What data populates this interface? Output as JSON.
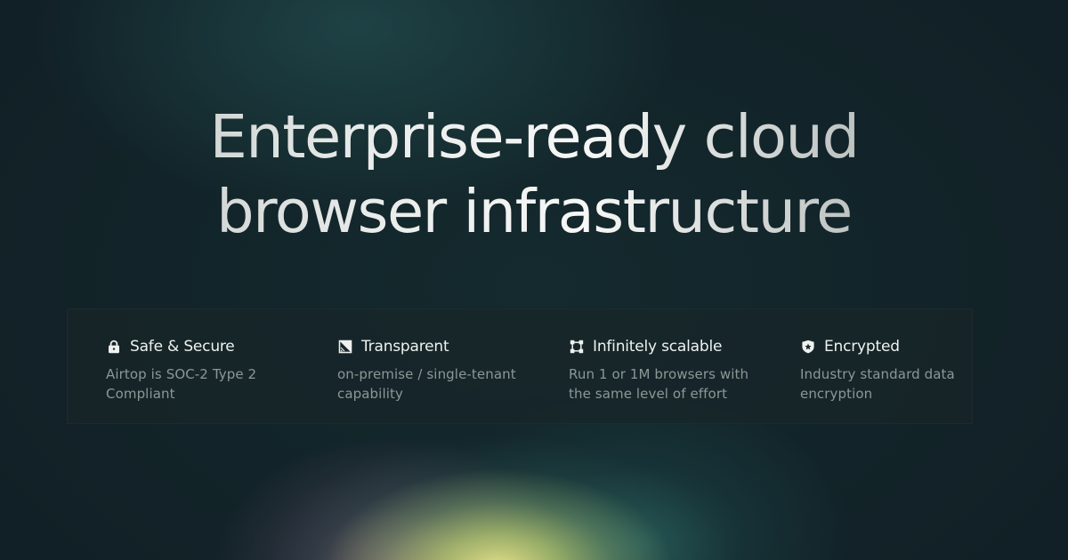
{
  "headline": {
    "line1": "Enterprise-ready cloud",
    "line2": "browser infrastructure"
  },
  "features": [
    {
      "icon": "lock-icon",
      "title": "Safe & Secure",
      "description": "Airtop is SOC-2 Type 2 Compliant"
    },
    {
      "icon": "transparent-icon",
      "title": "Transparent",
      "description": "on-premise / single-tenant capability"
    },
    {
      "icon": "scale-icon",
      "title": "Infinitely scalable",
      "description": "Run 1 or 1M browsers with the same level of effort"
    },
    {
      "icon": "shield-star-icon",
      "title": "Encrypted",
      "description": "Industry standard data encryption"
    }
  ],
  "colors": {
    "background": "#12242a",
    "panel": "#182628",
    "title_text": "#eef1f0",
    "description_text": "#8b9896",
    "glow": "#ece88c"
  }
}
